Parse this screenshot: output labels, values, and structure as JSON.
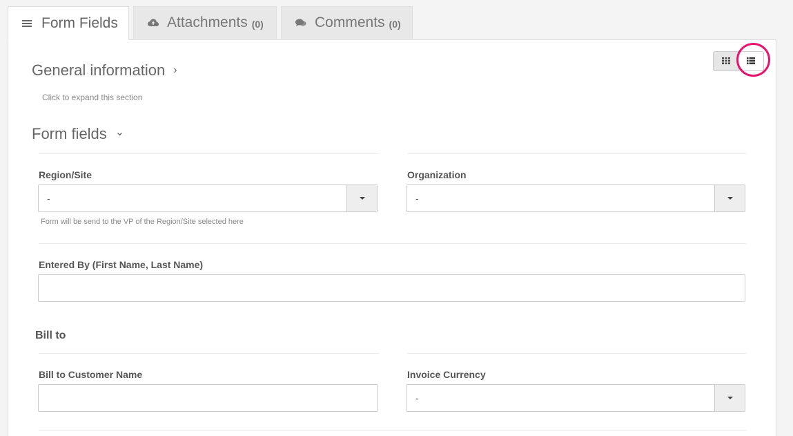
{
  "tabs": [
    {
      "label": "Form Fields",
      "icon": "list-lines-icon",
      "count": ""
    },
    {
      "label": "Attachments",
      "icon": "cloud-upload-icon",
      "count": "(0)"
    },
    {
      "label": "Comments",
      "icon": "chat-bubbles-icon",
      "count": "(0)"
    }
  ],
  "view_toggle": {
    "grid_icon": "grid-icon",
    "list_icon": "list-view-icon",
    "highlight_color": "#e6166d"
  },
  "sections": {
    "general": {
      "title": "General information",
      "chevron": "›",
      "hint": "Click to expand this section"
    },
    "form_fields": {
      "title": "Form fields",
      "chevron": "⌄"
    }
  },
  "fields": {
    "region": {
      "label": "Region/Site",
      "value": "-",
      "help": "Form will be send to the VP of the Region/Site selected here"
    },
    "organization": {
      "label": "Organization",
      "value": "-"
    },
    "entered_by": {
      "label": "Entered By (First Name, Last Name)",
      "value": ""
    },
    "bill_to_heading": "Bill to",
    "bill_customer": {
      "label": "Bill to Customer Name",
      "value": ""
    },
    "invoice_currency": {
      "label": "Invoice Currency",
      "value": "-"
    }
  }
}
